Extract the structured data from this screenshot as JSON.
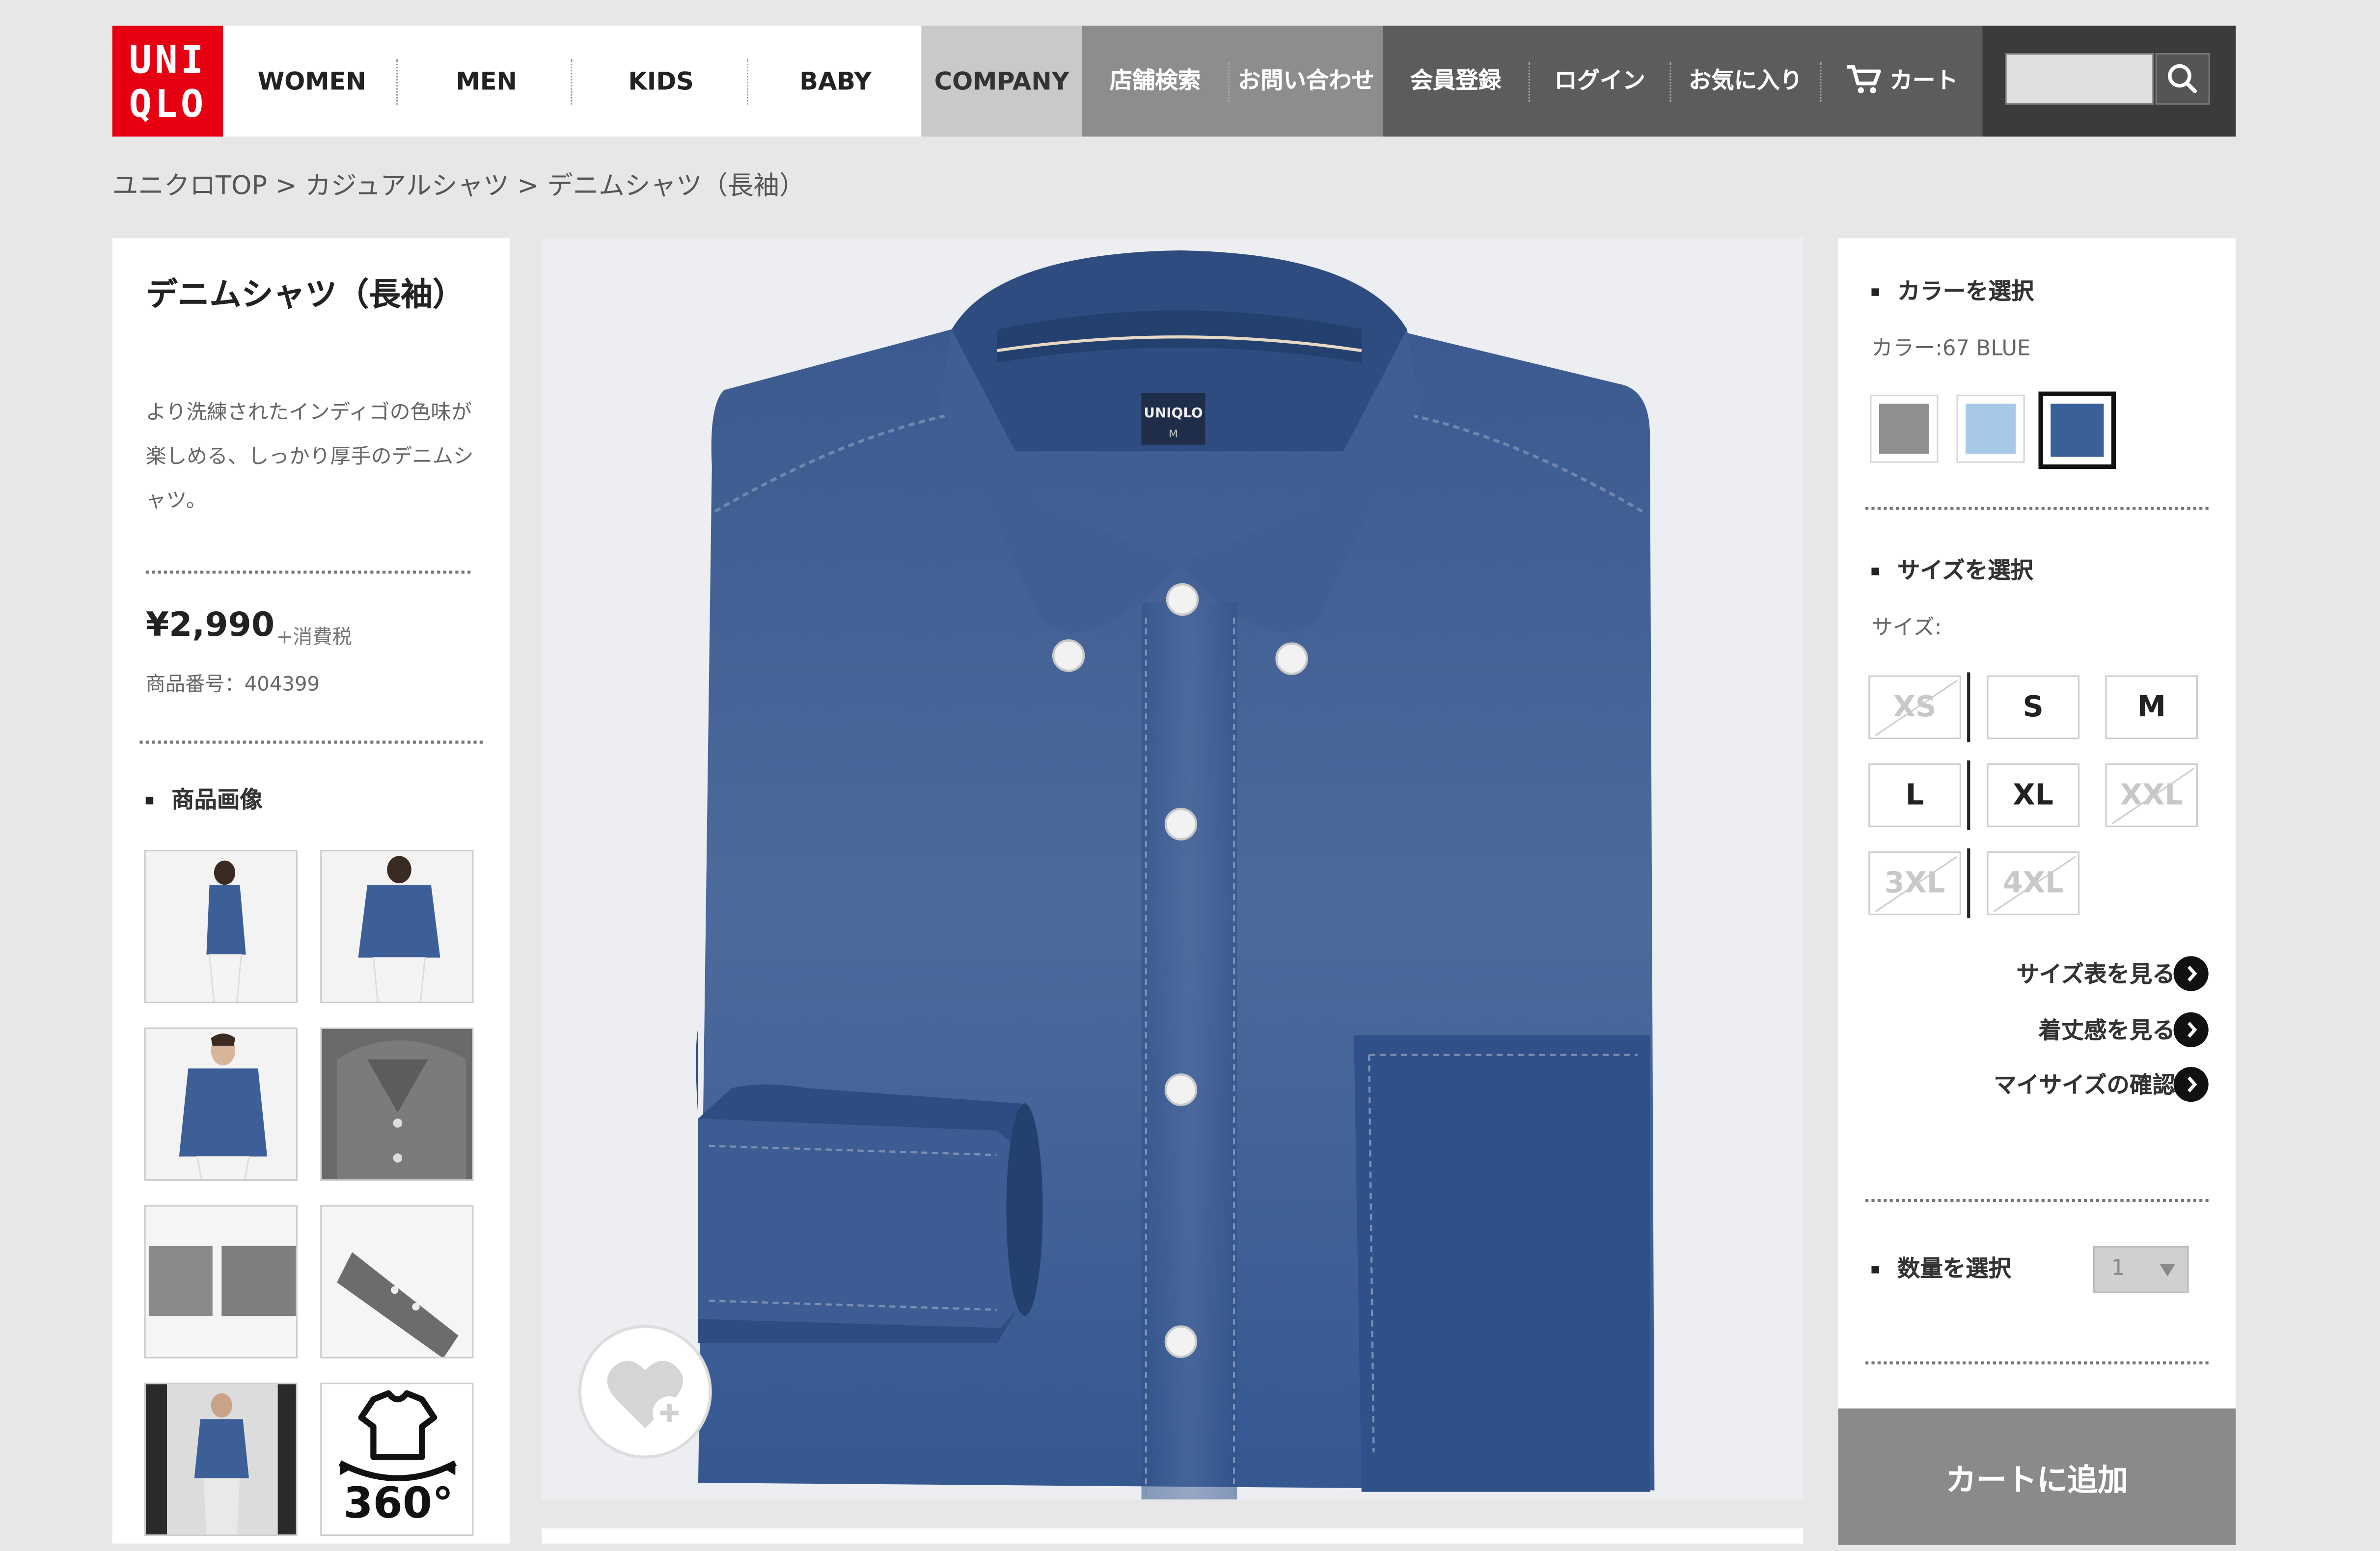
{
  "header": {
    "logo_top": "UNI",
    "logo_bottom": "QLO",
    "nav": [
      "WOMEN",
      "MEN",
      "KIDS",
      "BABY"
    ],
    "company": "COMPANY",
    "store_search": "店舗検索",
    "contact": "お問い合わせ",
    "register": "会員登録",
    "login": "ログイン",
    "favorites": "お気に入り",
    "cart": "カート",
    "search_value": ""
  },
  "breadcrumb": "ユニクロTOP > カジュアルシャツ > デニムシャツ（長袖）",
  "product": {
    "title": "デニムシャツ（長袖）",
    "description": "より洗練されたインディゴの色味が楽しめる、しっかり厚手のデニムシャツ。",
    "price": "¥2,990",
    "tax": "+消費税",
    "item_number": "商品番号：404399",
    "images_heading": "商品画像",
    "badge_360": "360°",
    "tag_logo": "UNIQLO",
    "tag_size": "M"
  },
  "options": {
    "color_heading": "カラーを選択",
    "color_label": "カラー:67 BLUE",
    "swatches": [
      {
        "name": "gray",
        "color": "#8f8f8f"
      },
      {
        "name": "light-blue",
        "color": "#a7c9e8"
      },
      {
        "name": "blue",
        "color": "#3a5f99",
        "selected": true
      }
    ],
    "size_heading": "サイズを選択",
    "size_label": "サイズ:",
    "sizes": [
      {
        "label": "XS",
        "available": false
      },
      {
        "label": "S",
        "available": true
      },
      {
        "label": "M",
        "available": true
      },
      {
        "label": "L",
        "available": true
      },
      {
        "label": "XL",
        "available": true
      },
      {
        "label": "XXL",
        "available": false
      },
      {
        "label": "3XL",
        "available": false
      },
      {
        "label": "4XL",
        "available": false
      }
    ],
    "size_chart": "サイズ表を見る",
    "fit": "着丈感を見る",
    "my_size": "マイサイズの確認",
    "qty_heading": "数量を選択",
    "qty_value": "1",
    "add_to_cart": "カートに追加"
  },
  "colors": {
    "brand_red": "#e60012",
    "denim": "#3a5f99"
  }
}
